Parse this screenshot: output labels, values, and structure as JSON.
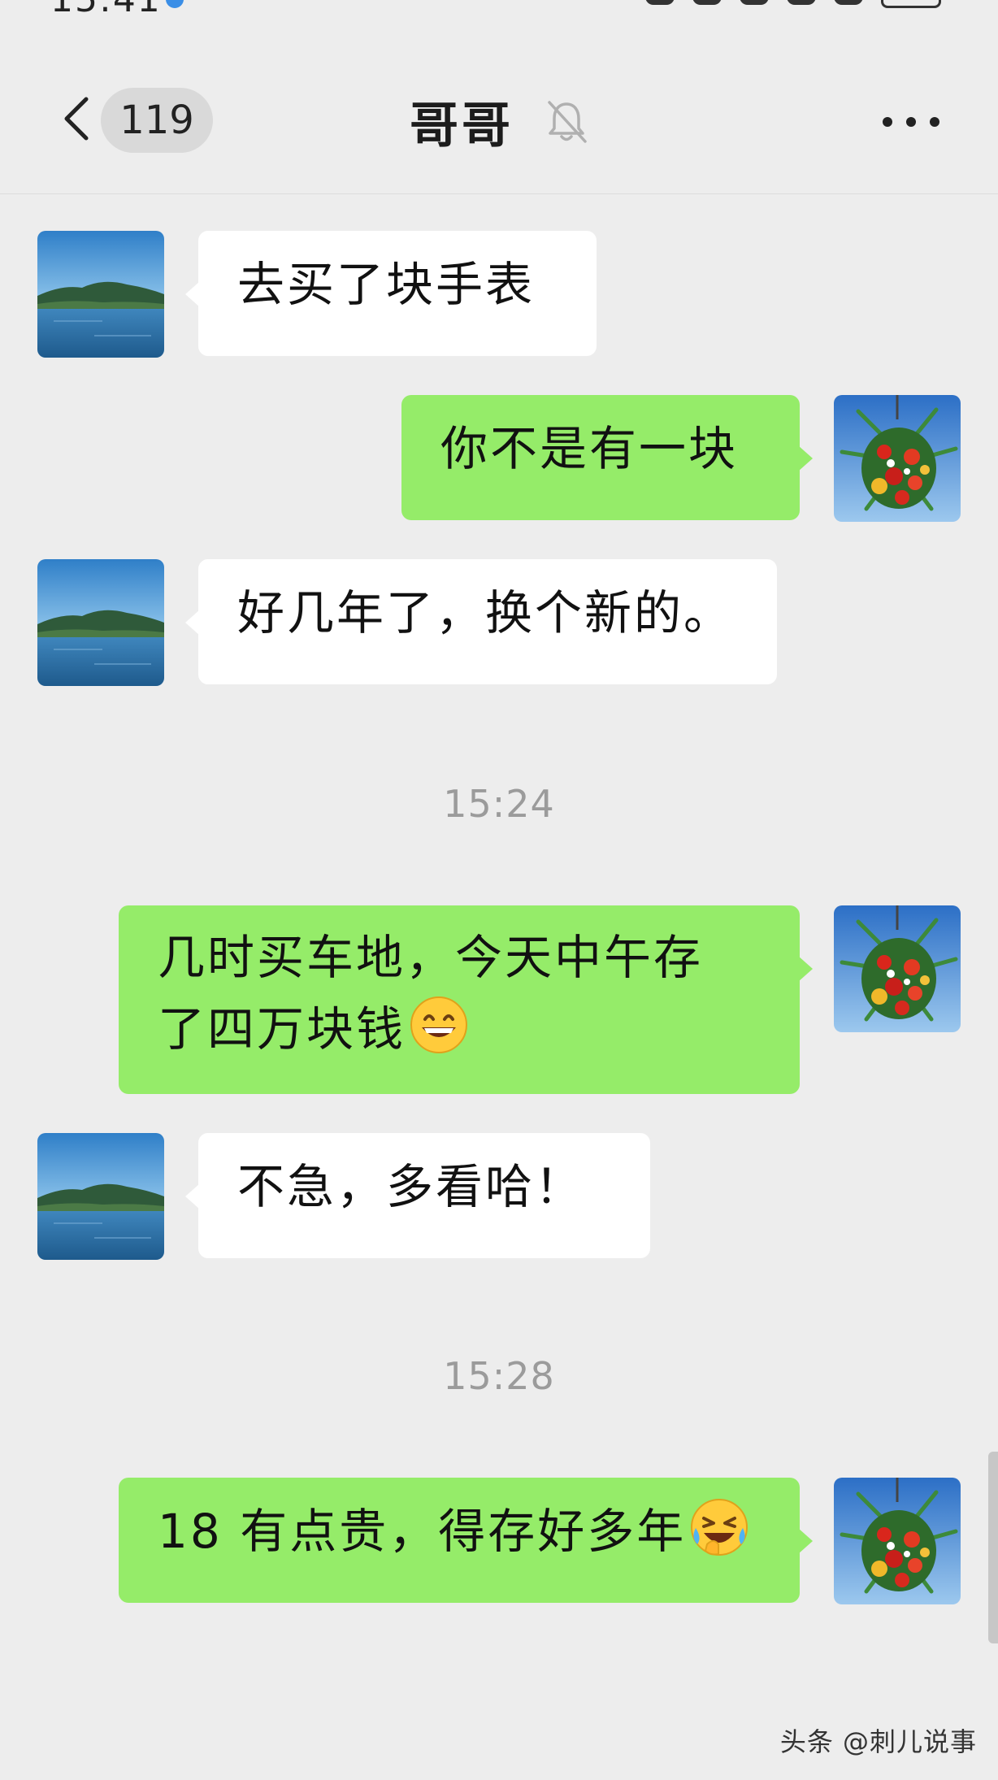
{
  "status_bar": {
    "time": "15:41"
  },
  "header": {
    "unread_count": "119",
    "title": "哥哥",
    "icons": {
      "back": "chevron-left-icon",
      "mute": "bell-off-icon",
      "more": "more-dots-icon"
    }
  },
  "messages": [
    {
      "from": "contact",
      "text": "去买了块手表"
    },
    {
      "from": "me",
      "text": "你不是有一块"
    },
    {
      "from": "contact",
      "text": "好几年了，换个新的。"
    },
    {
      "type": "time",
      "text": "15:24"
    },
    {
      "from": "me",
      "lines": [
        "几时买车地，今天中午存",
        "了四万块钱"
      ],
      "emoji": "grinning-face"
    },
    {
      "from": "contact",
      "text": "不急，多看哈！"
    },
    {
      "type": "time",
      "text": "15:28"
    },
    {
      "from": "me",
      "text": "18 有点贵，得存好多年",
      "emoji": "rolling-on-floor-laughing-face"
    }
  ],
  "colors": {
    "background": "#ededed",
    "my_bubble": "#95ec69",
    "their_bubble": "#ffffff",
    "timestamp": "#9b9b9b"
  },
  "watermark": "头条 @刺儿说事"
}
